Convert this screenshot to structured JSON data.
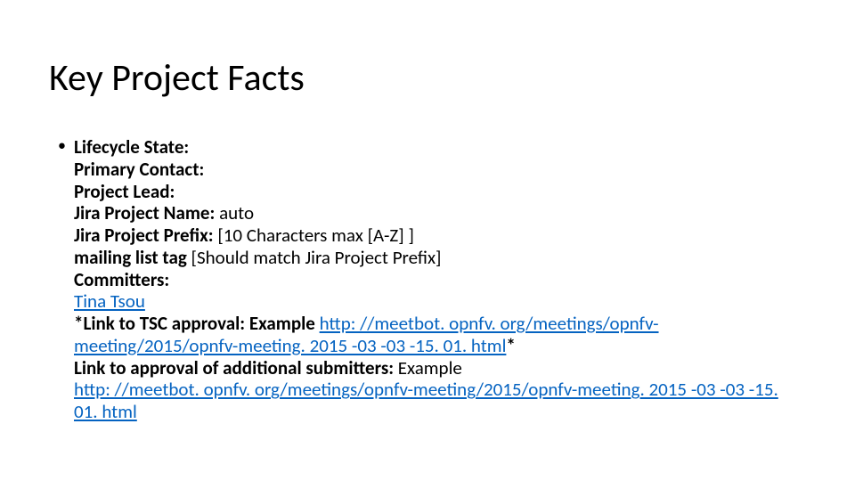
{
  "title": "Key Project Facts",
  "facts": {
    "lifecycle_label": "Lifecycle State:",
    "primary_contact_label": "Primary Contact:",
    "project_lead_label": "Project Lead:",
    "jira_name_label": "Jira Project Name: ",
    "jira_name_value": "auto",
    "jira_prefix_label": "Jira Project Prefix: ",
    "jira_prefix_value": "[10 Characters max [A-Z] ]",
    "mailing_tag_label": "mailing list tag ",
    "mailing_tag_value": "[Should match Jira Project Prefix]",
    "committers_label": "Committers:",
    "committer_1": "Tina Tsou",
    "tsc_prefix": "*Link to TSC approval: Example ",
    "tsc_link": "http: //meetbot. opnfv. org/meetings/opnfv-meeting/2015/opnfv-meeting. 2015 -03 -03 -15. 01. html",
    "tsc_suffix": "*",
    "additional_prefix": "Link to approval of additional submitters: ",
    "additional_example": "Example",
    "additional_link": "http: //meetbot. opnfv. org/meetings/opnfv-meeting/2015/opnfv-meeting. 2015 -03 -03 -15. 01. html"
  }
}
